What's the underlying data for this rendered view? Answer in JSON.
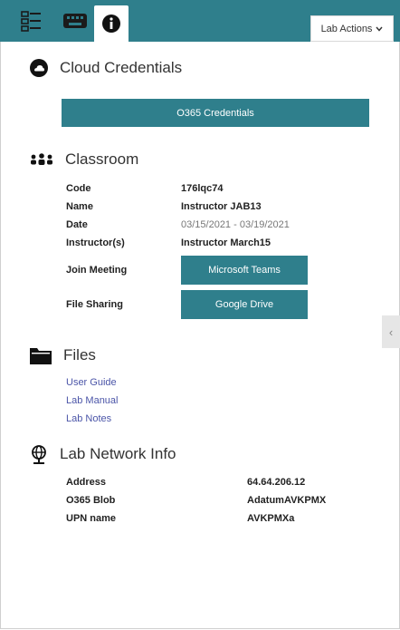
{
  "toolbar": {
    "lab_actions_label": "Lab Actions",
    "tabs": [
      {
        "icon": "list-icon"
      },
      {
        "icon": "keyboard-icon"
      },
      {
        "icon": "info-icon"
      }
    ]
  },
  "cloud": {
    "heading": "Cloud Credentials",
    "button_label": "O365 Credentials"
  },
  "classroom": {
    "heading": "Classroom",
    "rows": [
      {
        "label": "Code",
        "value": "176lqc74"
      },
      {
        "label": "Name",
        "value": "Instructor JAB13"
      },
      {
        "label": "Date",
        "value": "03/15/2021 - 03/19/2021"
      },
      {
        "label": "Instructor(s)",
        "value": "Instructor March15"
      }
    ],
    "join_meeting_label": "Join Meeting",
    "join_meeting_button": "Microsoft Teams",
    "file_sharing_label": "File Sharing",
    "file_sharing_button": "Google Drive"
  },
  "files": {
    "heading": "Files",
    "links": [
      "User Guide",
      "Lab Manual",
      "Lab Notes"
    ]
  },
  "network": {
    "heading": "Lab Network Info",
    "rows": [
      {
        "label": "Address",
        "value": "64.64.206.12"
      },
      {
        "label": "O365 Blob",
        "value": "AdatumAVKPMX"
      },
      {
        "label": "UPN name",
        "value": "AVKPMXa"
      }
    ]
  },
  "colors": {
    "accent": "#2f7f8c",
    "link": "#4b55a8"
  }
}
